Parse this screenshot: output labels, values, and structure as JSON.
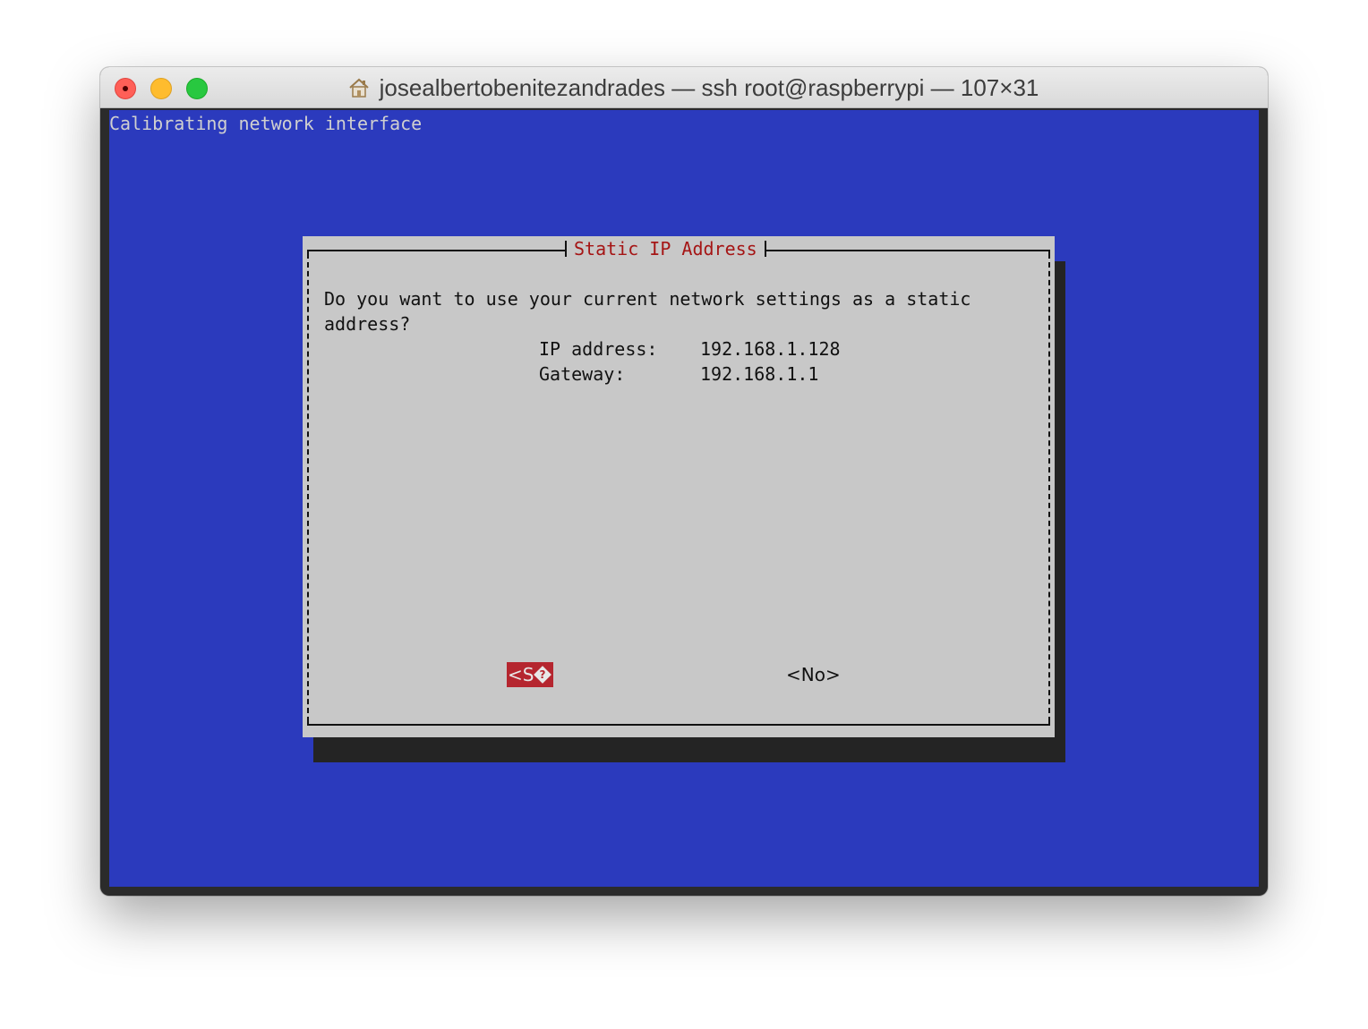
{
  "window": {
    "title": "josealbertobenitezandrades — ssh root@raspberrypi — 107×31",
    "title_icon": "home-icon"
  },
  "terminal": {
    "backtitle": "Calibrating network interface",
    "background_color": "#2b3abd"
  },
  "dialog": {
    "title": "Static IP Address",
    "message_line1": "Do you want to use your current network settings as a static",
    "message_line2": "address?",
    "ip_label": "IP address:",
    "ip_value": "192.168.1.128",
    "gateway_label": "Gateway:",
    "gateway_value": "192.168.1.1",
    "yes_button": "<S",
    "no_button": "<No>",
    "title_color": "#a51515",
    "selected_button_color": "#b5262f"
  }
}
